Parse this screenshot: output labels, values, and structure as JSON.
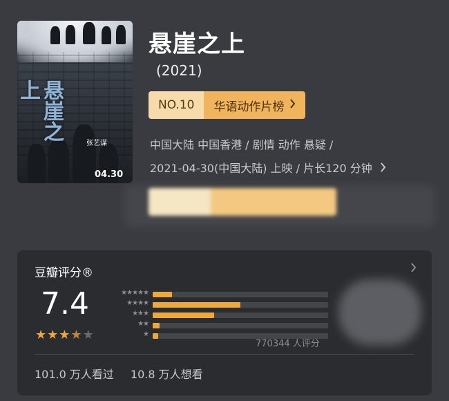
{
  "movie": {
    "title": "悬崖之上",
    "year": "(2021)",
    "rank_no": "NO.10",
    "rank_list": "华语动作片榜",
    "meta_line1": "中国大陆 中国香港 / 剧情 动作 悬疑 /",
    "meta_line2": "2021-04-30(中国大陆) 上映 / 片长120 分钟",
    "poster": {
      "title_art": "悬崖之上",
      "director": "张艺谋",
      "date": "04.30"
    }
  },
  "rating": {
    "card_title": "豆瓣评分®",
    "score": "7.4",
    "stars": 3.5,
    "distribution": [
      {
        "stars": "★★★★★",
        "fraction": 0.11
      },
      {
        "stars": "★★★★",
        "fraction": 0.5
      },
      {
        "stars": "★★★",
        "fraction": 0.35
      },
      {
        "stars": "★★",
        "fraction": 0.04
      },
      {
        "stars": "★",
        "fraction": 0.03
      }
    ],
    "votes": "770344 人评分",
    "watched": "101.0 万人看过",
    "want": "10.8 万人想看"
  },
  "icons": {
    "chevron": "chevron-right-icon"
  },
  "colors": {
    "background": "#3a3b40",
    "card": "#2b2c30",
    "accent": "#f0a83a",
    "rank_light": "#f7dcab",
    "rank_dark": "#f0b45c"
  }
}
